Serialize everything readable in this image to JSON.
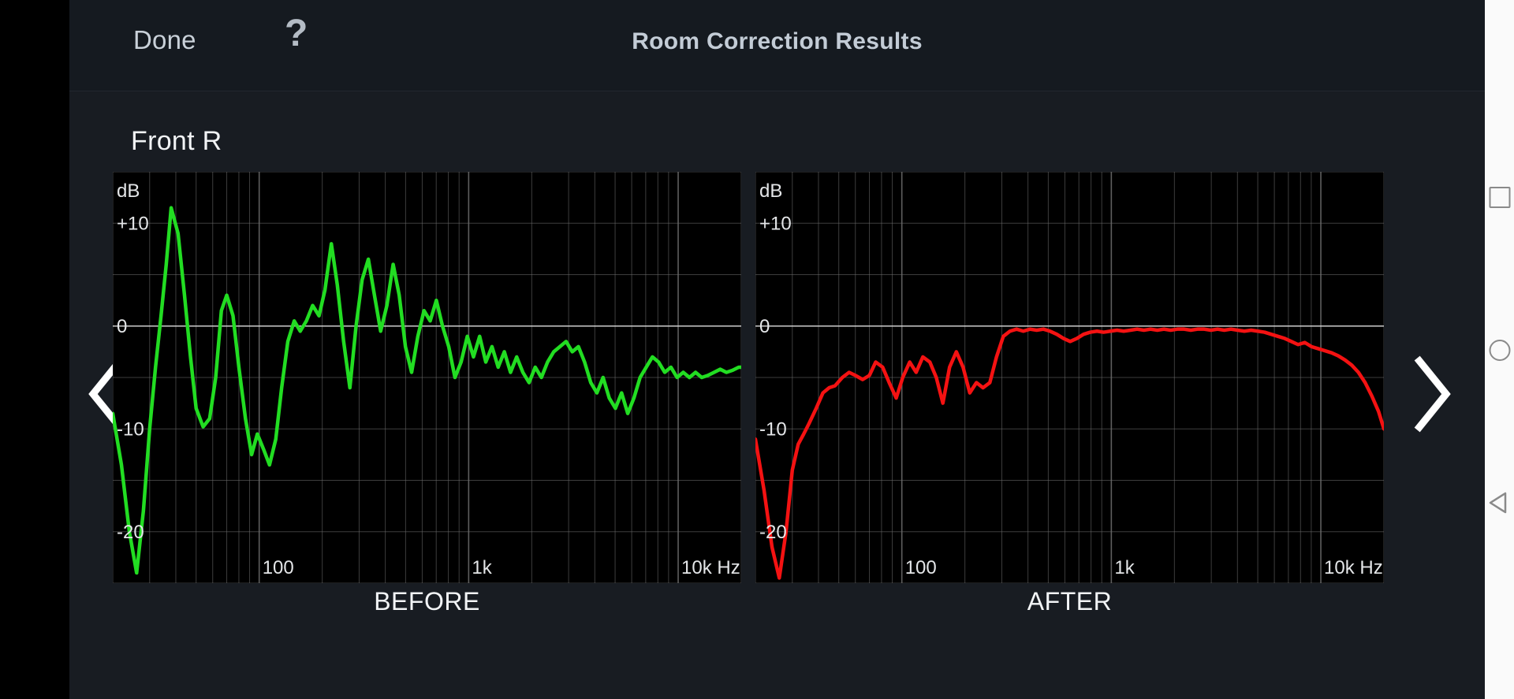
{
  "header": {
    "done_label": "Done",
    "help_label": "?",
    "title": "Room Correction Results"
  },
  "body": {
    "channel_label": "Front R"
  },
  "nav": {
    "prev_label": "previous-channel",
    "next_label": "next-channel"
  },
  "system_nav": {
    "recents": "recents-square",
    "home": "home-circle",
    "back": "back-triangle"
  },
  "colors": {
    "before_curve": "#22dd22",
    "after_curve": "#f41212",
    "plot_bg": "#000000",
    "grid": "#6f6f6f",
    "zero_line": "#d8d8d8",
    "app_bg": "#181c22",
    "header_bg": "#151a20",
    "title_text": "#c3ccd6"
  },
  "chart_data": [
    {
      "type": "line",
      "title": "BEFORE",
      "caption": "BEFORE",
      "ylabel": "dB",
      "xlabel": "Hz",
      "y_ticks": [
        "+10",
        "0",
        "-10",
        "-20"
      ],
      "y_tick_values": [
        10,
        0,
        -10,
        -20
      ],
      "ylim": [
        -25,
        15
      ],
      "x_ticks": [
        "100",
        "1k",
        "10k Hz"
      ],
      "x_tick_values": [
        100,
        1000,
        10000
      ],
      "xlim": [
        20,
        20000
      ],
      "x_scale": "log",
      "grid": true,
      "series_color": "#22dd22",
      "series": [
        {
          "name": "Front R before correction",
          "x": [
            20,
            22,
            24,
            26,
            28,
            30,
            32,
            34,
            36,
            38,
            41,
            44,
            47,
            50,
            54,
            58,
            62,
            66,
            70,
            75,
            80,
            86,
            92,
            98,
            105,
            112,
            120,
            128,
            137,
            147,
            157,
            168,
            180,
            193,
            206,
            221,
            236,
            253,
            271,
            290,
            310,
            332,
            355,
            380,
            407,
            436,
            466,
            499,
            534,
            572,
            612,
            655,
            701,
            750,
            803,
            860,
            920,
            985,
            1054,
            1128,
            1207,
            1292,
            1383,
            1480,
            1584,
            1695,
            1814,
            1942,
            2078,
            2224,
            2380,
            2547,
            2726,
            2917,
            3122,
            3341,
            3575,
            3826,
            4094,
            4381,
            4688,
            5017,
            5369,
            5746,
            6149,
            6580,
            7041,
            7535,
            8063,
            8628,
            9233,
            9880,
            10573,
            11314,
            12107,
            12956,
            13864,
            14836,
            15876,
            16989,
            18180,
            19454,
            20000
          ],
          "y": [
            -8.5,
            -13.5,
            -20.0,
            -24.0,
            -18.0,
            -10.0,
            -4.0,
            1.0,
            6.0,
            11.5,
            9.0,
            3.0,
            -3.0,
            -8.0,
            -9.8,
            -9.0,
            -5.0,
            1.5,
            3.0,
            1.0,
            -4.0,
            -9.0,
            -12.5,
            -10.5,
            -12.0,
            -13.5,
            -11.0,
            -6.0,
            -1.5,
            0.5,
            -0.5,
            0.5,
            2.0,
            1.0,
            3.5,
            8.0,
            4.0,
            -1.5,
            -6.0,
            0.0,
            4.5,
            6.5,
            3.0,
            -0.5,
            2.0,
            6.0,
            3.0,
            -2.0,
            -4.5,
            -1.0,
            1.5,
            0.5,
            2.5,
            0.0,
            -2.0,
            -5.0,
            -3.5,
            -1.0,
            -3.0,
            -1.0,
            -3.5,
            -2.0,
            -4.0,
            -2.5,
            -4.5,
            -3.0,
            -4.5,
            -5.5,
            -4.0,
            -5.0,
            -3.5,
            -2.5,
            -2.0,
            -1.5,
            -2.5,
            -2.0,
            -3.5,
            -5.5,
            -6.5,
            -5.0,
            -7.0,
            -8.0,
            -6.5,
            -8.5,
            -7.0,
            -5.0,
            -4.0,
            -3.0,
            -3.5,
            -4.5,
            -4.0,
            -5.0,
            -4.5,
            -5.0,
            -4.5,
            -5.0,
            -4.8,
            -4.5,
            -4.2,
            -4.5,
            -4.3,
            -4.0,
            -4.0
          ]
        }
      ]
    },
    {
      "type": "line",
      "title": "AFTER",
      "caption": "AFTER",
      "ylabel": "dB",
      "xlabel": "Hz",
      "y_ticks": [
        "+10",
        "0",
        "-10",
        "-20"
      ],
      "y_tick_values": [
        10,
        0,
        -10,
        -20
      ],
      "ylim": [
        -25,
        15
      ],
      "x_ticks": [
        "100",
        "1k",
        "10k Hz"
      ],
      "x_tick_values": [
        100,
        1000,
        10000
      ],
      "xlim": [
        20,
        20000
      ],
      "x_scale": "log",
      "grid": true,
      "series_color": "#f41212",
      "series": [
        {
          "name": "Front R after correction",
          "x": [
            20,
            22,
            24,
            26,
            28,
            30,
            32,
            34,
            36,
            39,
            42,
            45,
            48,
            52,
            56,
            60,
            65,
            70,
            75,
            81,
            87,
            94,
            101,
            109,
            117,
            126,
            136,
            146,
            157,
            169,
            182,
            196,
            211,
            227,
            244,
            263,
            283,
            305,
            328,
            353,
            380,
            409,
            440,
            474,
            510,
            549,
            591,
            636,
            685,
            737,
            793,
            854,
            919,
            989,
            1065,
            1146,
            1234,
            1328,
            1430,
            1539,
            1657,
            1783,
            1919,
            2066,
            2224,
            2394,
            2577,
            2774,
            2986,
            3214,
            3460,
            3725,
            4010,
            4317,
            4647,
            5002,
            5385,
            5797,
            6241,
            6719,
            7233,
            7786,
            8382,
            9023,
            9713,
            10456,
            11256,
            12117,
            13044,
            14042,
            15116,
            16272,
            17517,
            18857,
            20000
          ],
          "y": [
            -11.0,
            -16.0,
            -21.5,
            -24.5,
            -20.0,
            -14.0,
            -11.5,
            -10.5,
            -9.5,
            -8.0,
            -6.5,
            -6.0,
            -5.8,
            -5.0,
            -4.5,
            -4.8,
            -5.2,
            -4.8,
            -3.5,
            -4.0,
            -5.5,
            -7.0,
            -5.0,
            -3.5,
            -4.5,
            -3.0,
            -3.5,
            -5.0,
            -7.5,
            -4.0,
            -2.5,
            -4.0,
            -6.5,
            -5.5,
            -6.0,
            -5.5,
            -3.0,
            -1.0,
            -0.5,
            -0.3,
            -0.5,
            -0.3,
            -0.4,
            -0.3,
            -0.5,
            -0.8,
            -1.2,
            -1.5,
            -1.2,
            -0.8,
            -0.6,
            -0.5,
            -0.6,
            -0.5,
            -0.4,
            -0.5,
            -0.4,
            -0.3,
            -0.4,
            -0.3,
            -0.4,
            -0.3,
            -0.4,
            -0.3,
            -0.3,
            -0.4,
            -0.3,
            -0.3,
            -0.4,
            -0.3,
            -0.4,
            -0.3,
            -0.4,
            -0.5,
            -0.4,
            -0.5,
            -0.6,
            -0.8,
            -1.0,
            -1.2,
            -1.5,
            -1.8,
            -1.6,
            -2.0,
            -2.2,
            -2.4,
            -2.6,
            -2.9,
            -3.3,
            -3.8,
            -4.5,
            -5.5,
            -6.8,
            -8.3,
            -10.0
          ]
        }
      ]
    }
  ]
}
